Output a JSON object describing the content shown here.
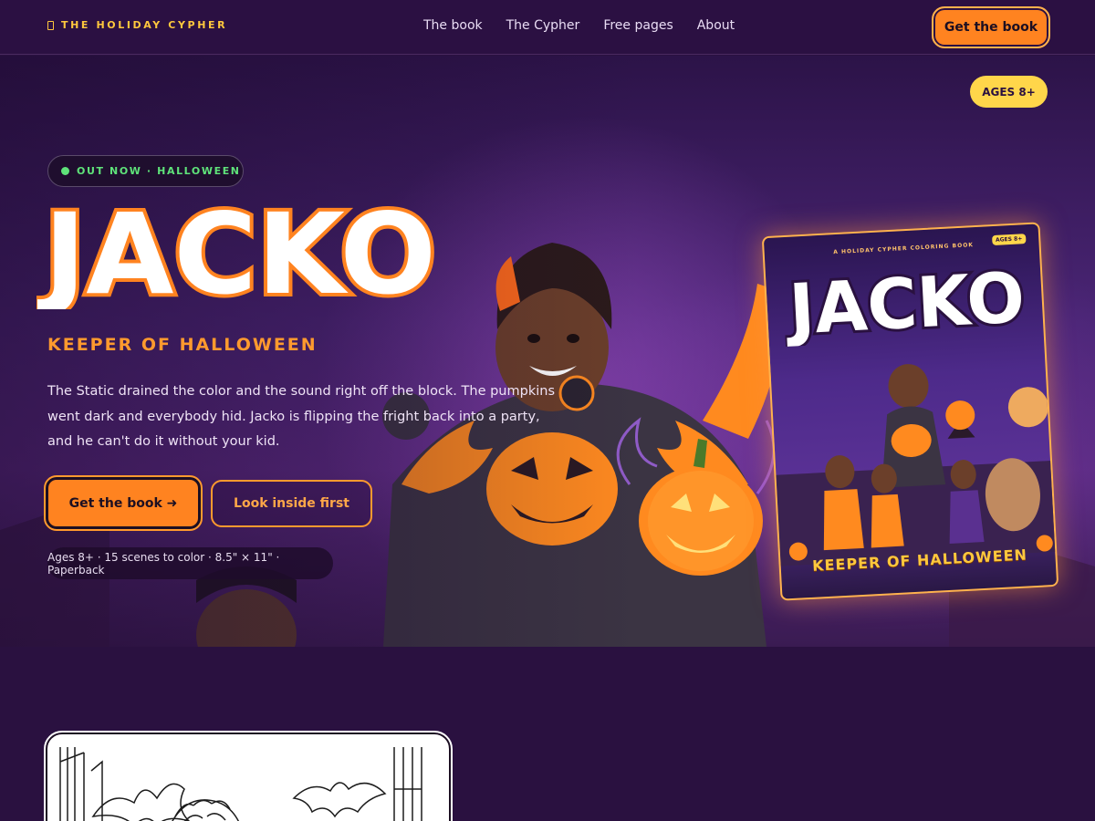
{
  "header": {
    "brand": "THE HOLIDAY CYPHER",
    "nav": [
      "The book",
      "The Cypher",
      "Free pages",
      "About"
    ],
    "cta": "Get the book"
  },
  "hero": {
    "ages_pill": "AGES 8+",
    "badge": "OUT NOW · HALLOWEEN",
    "title": "JACKO",
    "subtitle": "KEEPER OF HALLOWEEN",
    "description": "The Static drained the color and the sound right off the block. The pumpkins went dark and everybody hid. Jacko is flipping the fright back into a party, and he can't do it without your kid.",
    "primary_button": "Get the book ➜",
    "secondary_button": "Look inside first",
    "meta": "Ages 8+ · 15 scenes to color · 8.5\" × 11\" · Paperback"
  },
  "book_cover": {
    "kicker": "A HOLIDAY CYPHER COLORING BOOK",
    "ages": "AGES 8+",
    "title": "JACKO",
    "subtitle": "KEEPER OF HALLOWEEN"
  },
  "colors": {
    "background": "#2a1140",
    "accent_orange": "#ff8320",
    "accent_yellow": "#ffd64a",
    "badge_green": "#5fe37a"
  },
  "icons": {
    "brand": "book-icon",
    "badge": "live-dot-icon"
  }
}
